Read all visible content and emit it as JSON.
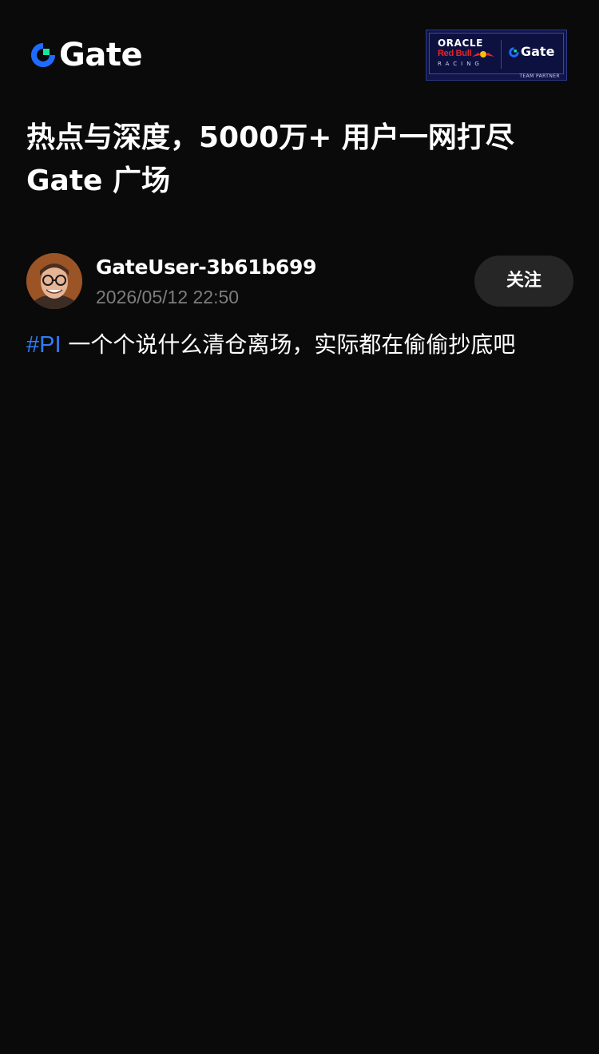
{
  "header": {
    "logo_text": "Gate",
    "partner_badge": {
      "oracle": "ORACLE",
      "red_bull": "Red Bull",
      "racing": "RACING",
      "gate": "Gate",
      "team_partner": "TEAM PARTNER"
    }
  },
  "headline": {
    "line1": "热点与深度，5000万+ 用户一网打尽",
    "line2": "Gate 广场"
  },
  "post": {
    "username": "GateUser-3b61b699",
    "timestamp": "2026/05/12 22:50",
    "follow_label": "关注",
    "hashtag": "#PI",
    "text": " 一个个说什么清仓离场，实际都在偷偷抄底吧"
  },
  "colors": {
    "background": "#0a0a0a",
    "accent_blue": "#2f7cf6",
    "brand_green": "#17e6a1",
    "button_bg": "#262626",
    "muted_text": "#7d7d7d"
  },
  "icons": {
    "logo": "gate-logo-icon",
    "avatar": "user-avatar"
  }
}
